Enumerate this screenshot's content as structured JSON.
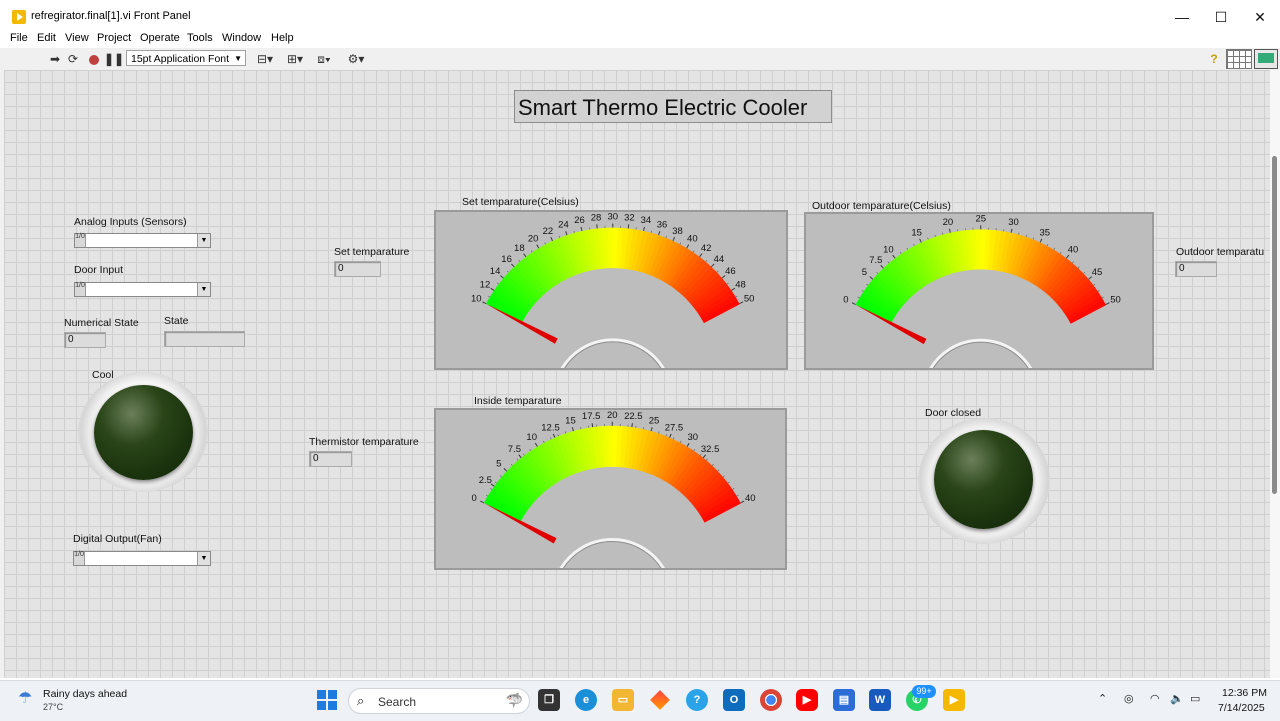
{
  "window": {
    "title": "refregirator.final[1].vi Front Panel",
    "minimize": "—",
    "maximize": "☐",
    "close": "✕"
  },
  "menu": [
    "File",
    "Edit",
    "View",
    "Project",
    "Operate",
    "Tools",
    "Window",
    "Help"
  ],
  "toolbar": {
    "font": "15pt Application Font",
    "help_icon": "?"
  },
  "panel": {
    "title": "Smart Thermo Electric Cooler",
    "analog_inputs_label": "Analog Inputs (Sensors)",
    "door_input_label": "Door Input",
    "numerical_state_label": "Numerical State",
    "numerical_state_value": "0",
    "state_label": "State",
    "state_value": "",
    "cool_label": "Cool",
    "digital_output_label": "Digital Output(Fan)",
    "set_temp_label": "Set temparature",
    "set_temp_value": "0",
    "thermistor_label": "Thermistor temparature",
    "thermistor_value": "0",
    "outdoor_temp_label": "Outdoor temparatu",
    "outdoor_temp_value": "0",
    "door_closed_label": "Door closed",
    "ring_radix": "1/0"
  },
  "gauges": [
    {
      "id": "set",
      "label": "Set temparature(Celsius)",
      "min": 10,
      "max": 50,
      "value": 0,
      "ticks": [
        "10",
        "12",
        "14",
        "16",
        "18",
        "20",
        "22",
        "24",
        "26",
        "28",
        "30",
        "32",
        "34",
        "36",
        "38",
        "40",
        "42",
        "44",
        "46",
        "48",
        "50"
      ]
    },
    {
      "id": "outdoor",
      "label": "Outdoor temparature(Celsius)",
      "min": 0,
      "max": 50,
      "value": 0,
      "ticks": [
        "0",
        "5",
        "7.5",
        "10",
        "15",
        "20",
        "25",
        "30",
        "35",
        "40",
        "45",
        "50"
      ],
      "tick_values": [
        0,
        5,
        7.5,
        10,
        15,
        20,
        25,
        30,
        35,
        40,
        45,
        50
      ]
    },
    {
      "id": "inside",
      "label": "Inside temparature",
      "min": 0,
      "max": 40,
      "value": 0,
      "ticks": [
        "0",
        "2.5",
        "5",
        "7.5",
        "10",
        "12.5",
        "15",
        "17.5",
        "20",
        "22.5",
        "25",
        "27.5",
        "30",
        "32.5",
        "40"
      ],
      "tick_values": [
        0,
        2.5,
        5,
        7.5,
        10,
        12.5,
        15,
        17.5,
        20,
        22.5,
        25,
        27.5,
        30,
        32.5,
        40
      ]
    }
  ],
  "colors": {
    "led_off": "#1f3a10",
    "gauge_low": "#00ff00",
    "gauge_mid": "#ffff00",
    "gauge_high": "#ff0000",
    "needle": "#e00000"
  },
  "taskbar": {
    "weather_text": "Rainy days ahead",
    "weather_temp": "27°C",
    "search_placeholder": "Search",
    "whatsapp_badge": "99+",
    "time": "12:36 PM",
    "date": "7/14/2025"
  }
}
